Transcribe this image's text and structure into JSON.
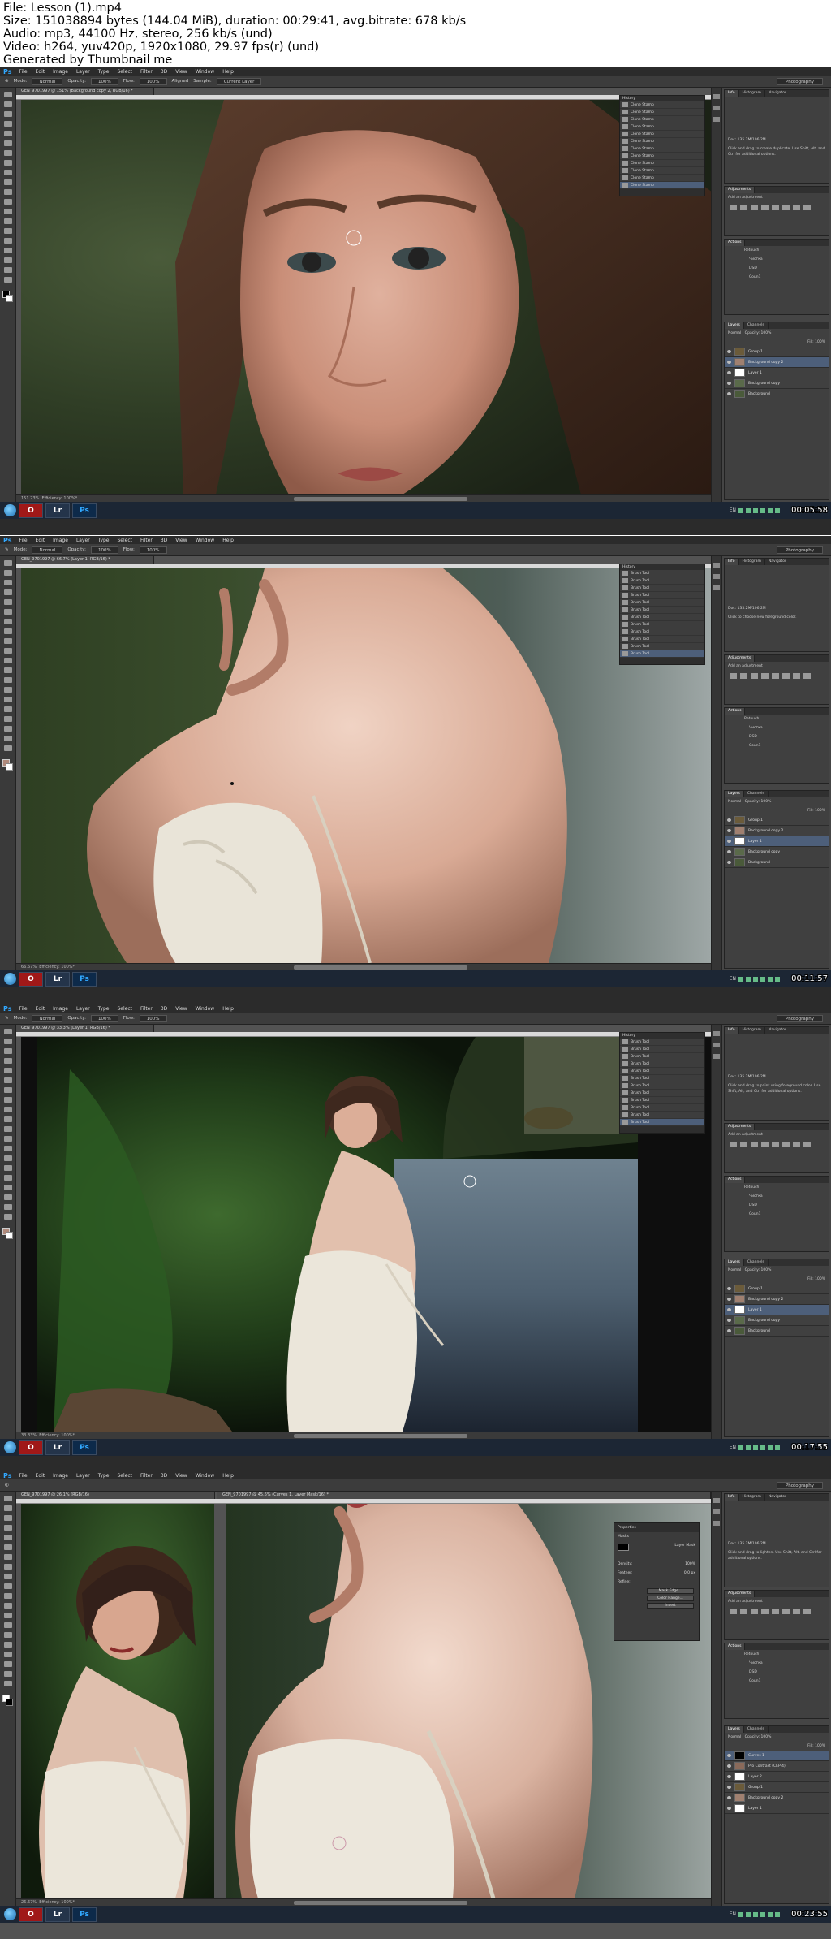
{
  "header": {
    "line1": "File: Lesson (1).mp4",
    "line2": "Size: 151038894 bytes (144.04 MiB), duration: 00:29:41, avg.bitrate: 678 kb/s",
    "line3": "Audio: mp3, 44100 Hz, stereo, 256 kb/s (und)",
    "line4": "Video: h264, yuv420p, 1920x1080, 29.97 fps(r) (und)",
    "line5": "Generated by Thumbnail me"
  },
  "app": {
    "logo": "Ps",
    "menu": [
      "File",
      "Edit",
      "Image",
      "Layer",
      "Type",
      "Select",
      "Filter",
      "3D",
      "View",
      "Window",
      "Help"
    ],
    "workspace": "Photography",
    "mode_label": "Mode:",
    "mode_value": "Normal",
    "opacity_label": "Opacity:",
    "opacity_value": "100%",
    "flow_label": "Flow:",
    "flow_value": "100%",
    "aligned_label": "Aligned",
    "sample_label": "Sample:",
    "sample_value": "Current Layer",
    "efficiency": "Efficiency: 100%*"
  },
  "taskbar": {
    "lr_label": "Lr",
    "ps_label": "Ps",
    "lang": "EN"
  },
  "frames": [
    {
      "timestamp": "00:05:58",
      "doc_tab": "GEN_9701997 @ 151% (Background copy 2, RGB/16) *",
      "zoom": "151.23%",
      "history_title": "History",
      "history_item": "Clone Stamp",
      "info_text": "Click and drag to create duplicate. Use Shift, Alt, and Ctrl for additional options.",
      "layers": [
        "Group 1",
        "Background copy 2",
        "Layer 1",
        "Background copy",
        "Background"
      ]
    },
    {
      "timestamp": "00:11:57",
      "doc_tab": "GEN_9701997 @ 66.7% (Layer 1, RGB/16) *",
      "zoom": "66.67%",
      "history_title": "History",
      "history_item": "Brush Tool",
      "info_text": "Click to choose new foreground color.",
      "layers": [
        "Group 1",
        "Background copy 2",
        "Layer 1",
        "Background copy",
        "Background"
      ]
    },
    {
      "timestamp": "00:17:55",
      "doc_tab": "GEN_9701997 @ 33.3% (Layer 1, RGB/16) *",
      "zoom": "33.33%",
      "history_title": "History",
      "history_item": "Brush Tool",
      "info_text": "Click and drag to paint using foreground color. Use Shift, Alt, and Ctrl for additional options.",
      "layers": [
        "Group 1",
        "Background copy 2",
        "Layer 1",
        "Background copy",
        "Background"
      ]
    },
    {
      "timestamp": "00:23:55",
      "doc_tab_a": "GEN_9701997 @ 26.1% (RGB/16)",
      "doc_tab_b": "GEN_9701997 @ 45.6% (Curves 1, Layer Mask/16) *",
      "zoom": "26.67%",
      "props_title": "Properties",
      "props_masks": "Masks",
      "props_layer_mask": "Layer Mask",
      "props_density_label": "Density:",
      "props_density_value": "100%",
      "props_feather_label": "Feather:",
      "props_feather_value": "0.0 px",
      "props_refine": "Refine:",
      "props_btn1": "Mask Edge...",
      "props_btn2": "Color Range...",
      "props_btn3": "Invert",
      "info_text": "Click and drag to lighten. Use Shift, Alt, and Ctrl for additional options.",
      "layers": [
        "Curves 1",
        "Pro Contrast (CEP 4)",
        "Layer 2",
        "Group 1",
        "Background copy 2",
        "Layer 1"
      ]
    }
  ],
  "panels": {
    "info_tab": "Info",
    "histogram_tab": "Histogram",
    "navigator_tab": "Navigator",
    "doc_size": "Doc: 135.2M/106.2M",
    "adjustments_title": "Adjustments",
    "adjustments_hint": "Add an adjustment",
    "actions_title": "Actions",
    "actions_items": [
      "Retouch",
      "Чистка",
      "DSD",
      "Coun1"
    ],
    "layers_tab": "Layers",
    "channels_tab": "Channels",
    "blend_mode": "Normal",
    "opacity": "Opacity: 100%",
    "fill": "Fill: 100%"
  }
}
